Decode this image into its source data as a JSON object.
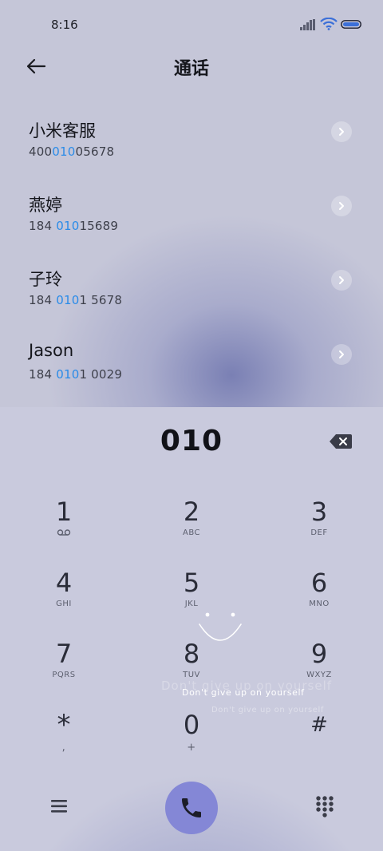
{
  "status": {
    "time": "8:16"
  },
  "header": {
    "title": "通话"
  },
  "contacts": [
    {
      "name": "小米客服",
      "number_pre": "400",
      "number_hl": "010",
      "number_post": "05678"
    },
    {
      "name": "燕婷",
      "number_pre": "184 ",
      "number_hl": "010",
      "number_post": "15689"
    },
    {
      "name": "子玲",
      "number_pre": "184 ",
      "number_hl": "010",
      "number_post": "1 5678"
    },
    {
      "name": "Jason",
      "number_pre": "184 ",
      "number_hl": "010",
      "number_post": "1 0029"
    }
  ],
  "dialer": {
    "input": "010",
    "keys": [
      {
        "digit": "1",
        "letters": ""
      },
      {
        "digit": "2",
        "letters": "ABC"
      },
      {
        "digit": "3",
        "letters": "DEF"
      },
      {
        "digit": "4",
        "letters": "GHI"
      },
      {
        "digit": "5",
        "letters": "JKL"
      },
      {
        "digit": "6",
        "letters": "MNO"
      },
      {
        "digit": "7",
        "letters": "PQRS"
      },
      {
        "digit": "8",
        "letters": "TUV"
      },
      {
        "digit": "9",
        "letters": "WXYZ"
      },
      {
        "digit": "*",
        "letters": ","
      },
      {
        "digit": "0",
        "letters": "+"
      },
      {
        "digit": "#",
        "letters": ""
      }
    ],
    "voicemail_icon": "voicemail-icon"
  },
  "overlay": {
    "message_main": "Don't give up on yourself",
    "message_ghost": "Don't give up on yourself",
    "message_faint": "Don't give up on yourself"
  },
  "colors": {
    "highlight": "#2a8be8",
    "call_button": "#8487d6"
  }
}
